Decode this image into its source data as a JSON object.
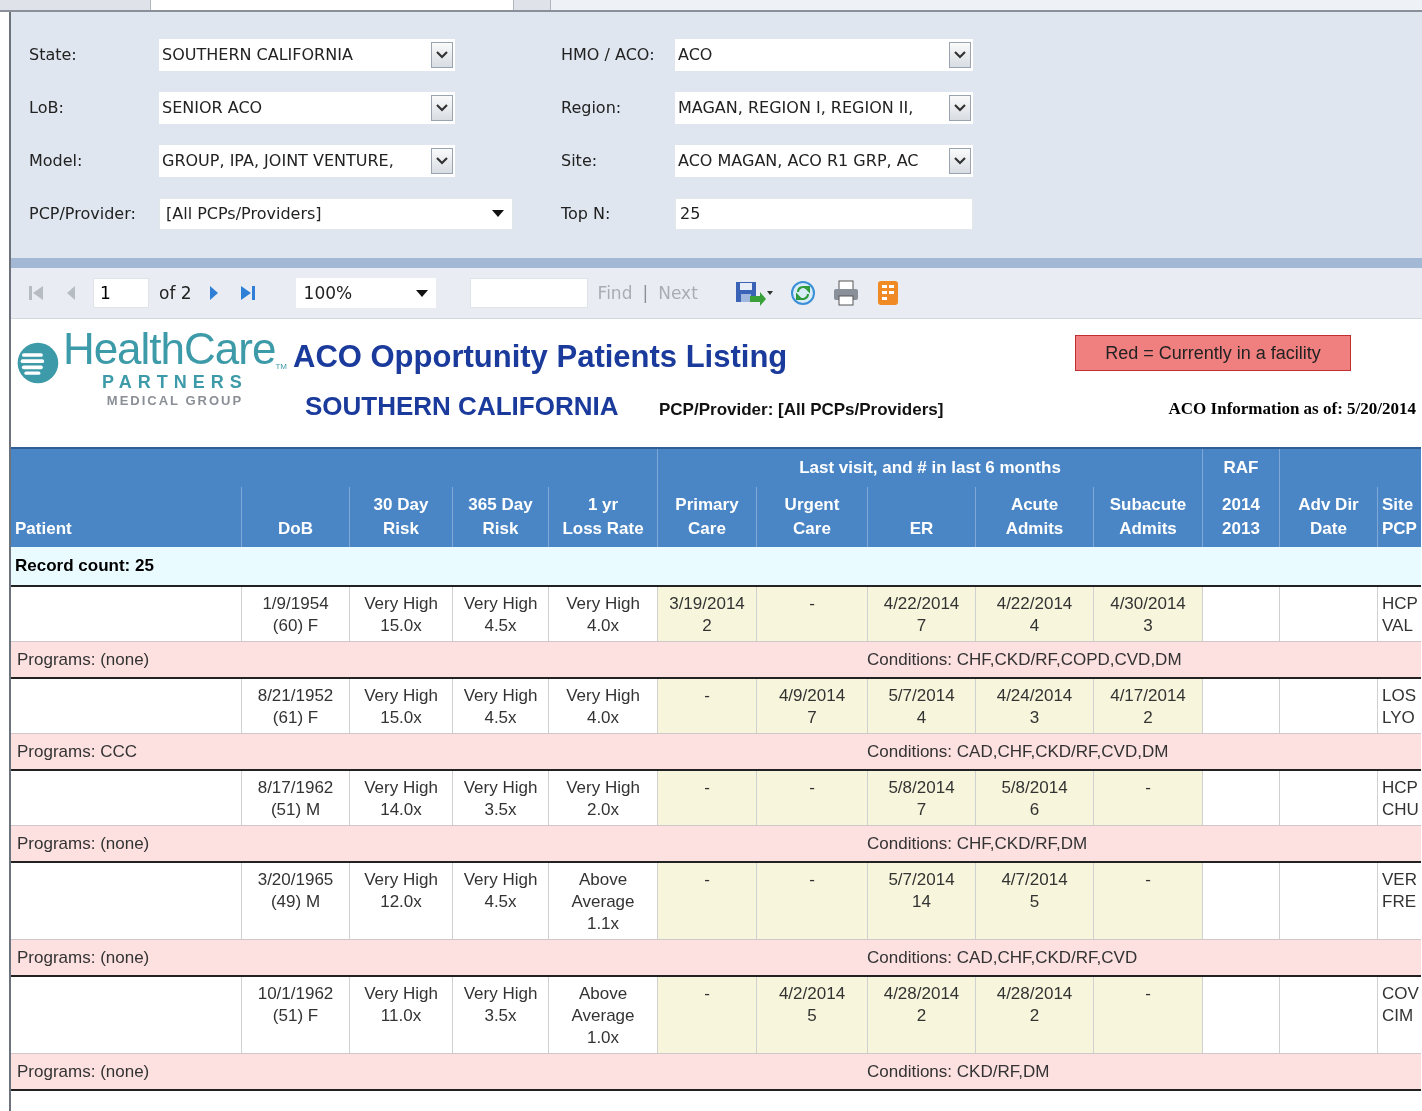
{
  "tabs": [
    {
      "selected": false
    },
    {
      "selected": true
    },
    {
      "selected": false
    }
  ],
  "filters": {
    "left": [
      {
        "label": "State:",
        "value": "SOUTHERN CALIFORNIA",
        "kind": "dropdown"
      },
      {
        "label": "LoB:",
        "value": "SENIOR ACO",
        "kind": "dropdown"
      },
      {
        "label": "Model:",
        "value": "GROUP, IPA, JOINT VENTURE,",
        "kind": "dropdown"
      },
      {
        "label": "PCP/Provider:",
        "value": "[All PCPs/Providers]",
        "kind": "select"
      }
    ],
    "right": [
      {
        "label": "HMO / ACO:",
        "value": "ACO",
        "kind": "dropdown"
      },
      {
        "label": "Region:",
        "value": "MAGAN, REGION I, REGION II,",
        "kind": "dropdown"
      },
      {
        "label": "Site:",
        "value": "ACO MAGAN, ACO R1 GRP, AC",
        "kind": "dropdown"
      },
      {
        "label": "Top N:",
        "value": "25",
        "kind": "text"
      }
    ]
  },
  "toolbar": {
    "nav": [
      {
        "kind": "first",
        "disabled": true
      },
      {
        "kind": "previous",
        "disabled": true
      }
    ],
    "page": "1",
    "page_count": "of 2",
    "nav_after": [
      {
        "kind": "next",
        "disabled": false
      },
      {
        "kind": "last",
        "disabled": false
      }
    ],
    "zoom": "100%",
    "find": {
      "label": "Find",
      "disabled": true
    },
    "separator": "|",
    "next": {
      "label": "Next",
      "disabled": true
    }
  },
  "report": {
    "logo": {
      "name": "HealthCare",
      "line2": "PARTNERS",
      "line3": "MEDICAL GROUP",
      "tm": "TM"
    },
    "title": "ACO Opportunity Patients Listing",
    "subtitle": "SOUTHERN CALIFORNIA",
    "provider": "PCP/Provider: [All PCPs/Providers]",
    "legend": "Red = Currently in a facility",
    "as_of": "ACO Information as of: 5/20/2014"
  },
  "table": {
    "group_headers": [
      {
        "label": "Last visit, and # in last 6 months"
      },
      {
        "label": "RAF"
      }
    ],
    "columns": [
      [
        "Patient"
      ],
      [
        "DoB"
      ],
      [
        "30 Day",
        "Risk"
      ],
      [
        "365 Day",
        "Risk"
      ],
      [
        "1 yr",
        "Loss Rate"
      ],
      [
        "Primary",
        "Care"
      ],
      [
        "Urgent",
        "Care"
      ],
      [
        "ER"
      ],
      [
        "Acute",
        "Admits"
      ],
      [
        "Subacute",
        "Admits"
      ],
      [
        "2014",
        "2013"
      ],
      [
        "Adv Dir",
        "Date"
      ],
      [
        "Site",
        "PCP"
      ]
    ],
    "record_count": "Record count: 25",
    "rows": [
      {
        "dob": [
          "1/9/1954",
          "(60) F"
        ],
        "risk_30": [
          "Very High",
          "15.0x"
        ],
        "risk_365": [
          "Very High",
          "4.5x"
        ],
        "loss_rate": [
          "Very High",
          "4.0x"
        ],
        "primary_care": [
          "3/19/2014",
          "2"
        ],
        "urgent_care": [
          "-"
        ],
        "er": [
          "4/22/2014",
          "7"
        ],
        "acute": [
          "4/22/2014",
          "4"
        ],
        "subacute": [
          "4/30/2014",
          "3"
        ],
        "site_pcp": [
          "HCP",
          "VAL"
        ],
        "programs": "Programs: (none)",
        "conditions": "Conditions: CHF,CKD/RF,COPD,CVD,DM"
      },
      {
        "dob": [
          "8/21/1952",
          "(61) F"
        ],
        "risk_30": [
          "Very High",
          "15.0x"
        ],
        "risk_365": [
          "Very High",
          "4.5x"
        ],
        "loss_rate": [
          "Very High",
          "4.0x"
        ],
        "primary_care": [
          "-"
        ],
        "urgent_care": [
          "4/9/2014",
          "7"
        ],
        "er": [
          "5/7/2014",
          "4"
        ],
        "acute": [
          "4/24/2014",
          "3"
        ],
        "subacute": [
          "4/17/2014",
          "2"
        ],
        "site_pcp": [
          "LOS",
          "LYO"
        ],
        "programs": "Programs: CCC",
        "conditions": "Conditions: CAD,CHF,CKD/RF,CVD,DM"
      },
      {
        "dob": [
          "8/17/1962",
          "(51) M"
        ],
        "risk_30": [
          "Very High",
          "14.0x"
        ],
        "risk_365": [
          "Very High",
          "3.5x"
        ],
        "loss_rate": [
          "Very High",
          "2.0x"
        ],
        "primary_care": [
          "-"
        ],
        "urgent_care": [
          "-"
        ],
        "er": [
          "5/8/2014",
          "7"
        ],
        "acute": [
          "5/8/2014",
          "6"
        ],
        "subacute": [
          "-"
        ],
        "site_pcp": [
          "HCP",
          "CHU"
        ],
        "programs": "Programs: (none)",
        "conditions": "Conditions: CHF,CKD/RF,DM"
      },
      {
        "dob": [
          "3/20/1965",
          "(49) M"
        ],
        "risk_30": [
          "Very High",
          "12.0x"
        ],
        "risk_365": [
          "Very High",
          "4.5x"
        ],
        "loss_rate": [
          "Above",
          "Average",
          "1.1x"
        ],
        "primary_care": [
          "-"
        ],
        "urgent_care": [
          "-"
        ],
        "er": [
          "5/7/2014",
          "14"
        ],
        "acute": [
          "4/7/2014",
          "5"
        ],
        "subacute": [
          "-"
        ],
        "site_pcp": [
          "VER",
          "FRE"
        ],
        "programs": "Programs: (none)",
        "conditions": "Conditions: CAD,CHF,CKD/RF,CVD"
      },
      {
        "dob": [
          "10/1/1962",
          "(51) F"
        ],
        "risk_30": [
          "Very High",
          "11.0x"
        ],
        "risk_365": [
          "Very High",
          "3.5x"
        ],
        "loss_rate": [
          "Above",
          "Average",
          "1.0x"
        ],
        "primary_care": [
          "-"
        ],
        "urgent_care": [
          "4/2/2014",
          "5"
        ],
        "er": [
          "4/28/2014",
          "2"
        ],
        "acute": [
          "4/28/2014",
          "2"
        ],
        "subacute": [
          "-"
        ],
        "site_pcp": [
          "COV",
          "CIM"
        ],
        "programs": "Programs: (none)",
        "conditions": "Conditions: CKD/RF,DM"
      }
    ]
  }
}
